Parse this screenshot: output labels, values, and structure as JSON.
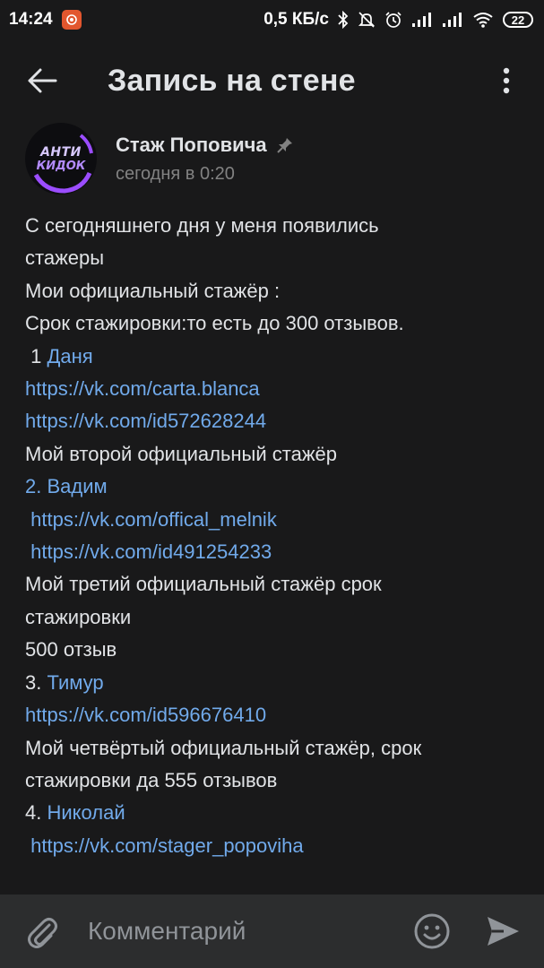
{
  "status_bar": {
    "time": "14:24",
    "network_speed": "0,5 КБ/с",
    "battery": "22",
    "icons": [
      "screen-recorder-icon",
      "bluetooth-icon",
      "mute-icon",
      "alarm-icon",
      "signal-icon",
      "signal-icon",
      "wifi-icon",
      "battery-icon"
    ]
  },
  "header": {
    "title": "Запись на стене",
    "back_icon": "arrow-left-icon",
    "menu_icon": "more-vertical-icon"
  },
  "post": {
    "avatar_text_top": "АНТИ",
    "avatar_text_bottom": "КИДОК",
    "author": "Стаж Поповича",
    "pinned_icon": "pin-icon",
    "time": "сегодня в 0:20",
    "lines": [
      {
        "parts": [
          {
            "text": "С сегодняшнего дня у меня появились",
            "link": false
          }
        ]
      },
      {
        "parts": [
          {
            "text": "стажеры",
            "link": false
          }
        ]
      },
      {
        "parts": [
          {
            "text": "Мои официальный стажёр :",
            "link": false
          }
        ]
      },
      {
        "parts": [
          {
            "text": "Срок стажировки:то есть до 300 отзывов.",
            "link": false
          }
        ]
      },
      {
        "parts": [
          {
            "text": " 1 ",
            "link": false
          },
          {
            "text": "Даня",
            "link": true
          }
        ]
      },
      {
        "parts": [
          {
            "text": "https://vk.com/carta.blanca",
            "link": true
          }
        ]
      },
      {
        "parts": [
          {
            "text": "https://vk.com/id572628244",
            "link": true
          }
        ]
      },
      {
        "parts": [
          {
            "text": "Мой второй официальный стажёр",
            "link": false
          }
        ]
      },
      {
        "parts": [
          {
            "text": "2. Вадим",
            "link": true
          }
        ]
      },
      {
        "parts": [
          {
            "text": " ",
            "link": false
          },
          {
            "text": "https://vk.com/offical_melnik",
            "link": true
          }
        ]
      },
      {
        "parts": [
          {
            "text": " ",
            "link": false
          },
          {
            "text": "https://vk.com/id491254233",
            "link": true
          }
        ]
      },
      {
        "parts": [
          {
            "text": "Мой третий официальный стажёр срок",
            "link": false
          }
        ]
      },
      {
        "parts": [
          {
            "text": "стажировки",
            "link": false
          }
        ]
      },
      {
        "parts": [
          {
            "text": "500 отзыв",
            "link": false
          }
        ]
      },
      {
        "parts": [
          {
            "text": "3. ",
            "link": false
          },
          {
            "text": "Тимур",
            "link": true
          }
        ]
      },
      {
        "parts": [
          {
            "text": "https://vk.com/id596676410",
            "link": true
          }
        ]
      },
      {
        "parts": [
          {
            "text": "Мой четвёртый официальный стажёр, срок",
            "link": false
          }
        ]
      },
      {
        "parts": [
          {
            "text": "стажировки да 555 отзывов",
            "link": false
          }
        ]
      },
      {
        "parts": [
          {
            "text": "4. ",
            "link": false
          },
          {
            "text": "Николай",
            "link": true
          }
        ]
      },
      {
        "parts": [
          {
            "text": " ",
            "link": false
          },
          {
            "text": "https://vk.com/stager_popoviha",
            "link": true
          }
        ]
      }
    ]
  },
  "comment_bar": {
    "placeholder": "Комментарий",
    "attach_icon": "paperclip-icon",
    "emoji_icon": "smile-icon",
    "send_icon": "send-icon"
  },
  "colors": {
    "background": "#19191a",
    "text": "#e1e3e6",
    "link": "#71aaeb",
    "secondary": "#828282",
    "comment_bar": "#2c2d2e"
  }
}
